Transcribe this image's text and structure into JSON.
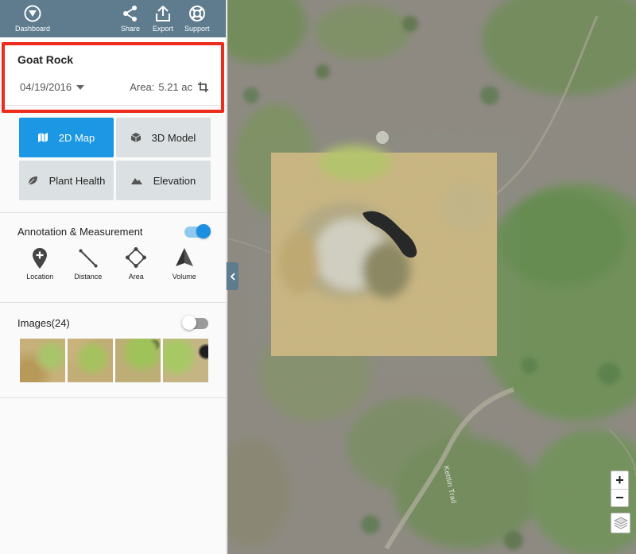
{
  "topbar": {
    "dashboard_label": "Dashboard",
    "share_label": "Share",
    "export_label": "Export",
    "support_label": "Support"
  },
  "project": {
    "name": "Goat Rock",
    "date": "04/19/2016",
    "area_label": "Area:",
    "area_value": "5.21 ac"
  },
  "modes": [
    {
      "label": "2D Map",
      "icon": "map-icon",
      "active": true
    },
    {
      "label": "3D Model",
      "icon": "cube-icon",
      "active": false
    },
    {
      "label": "Plant Health",
      "icon": "leaf-icon",
      "active": false
    },
    {
      "label": "Elevation",
      "icon": "mountain-icon",
      "active": false
    }
  ],
  "annotation": {
    "title": "Annotation & Measurement",
    "toggle_on": true,
    "tools": [
      {
        "label": "Location",
        "icon": "location-pin-icon"
      },
      {
        "label": "Distance",
        "icon": "ruler-line-icon"
      },
      {
        "label": "Area",
        "icon": "polygon-icon"
      },
      {
        "label": "Volume",
        "icon": "pyramid-icon"
      }
    ]
  },
  "images": {
    "title": "Images(24)",
    "toggle_on": false
  },
  "map": {
    "trail_label": "Kettlin Trail",
    "zoom_in": "+",
    "zoom_out": "−"
  },
  "colors": {
    "topbar": "#5e7c8e",
    "accent": "#1b97e3",
    "highlight": "#ec2b1c",
    "mode_button": "#dbe0e2"
  }
}
